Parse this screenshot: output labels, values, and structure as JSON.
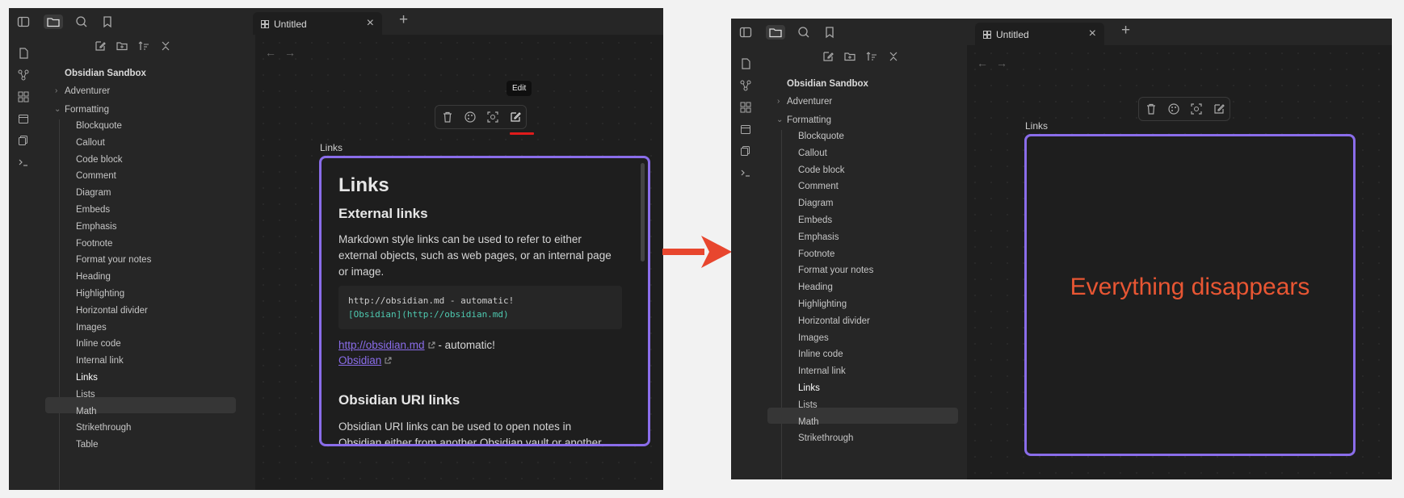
{
  "colors": {
    "accent": "#8a6dea",
    "annotation_red": "#e01b1b",
    "arrow": "#e8462e",
    "message": "#e85633"
  },
  "tab_title": "Untitled",
  "tooltip": "Edit",
  "vault": "Obsidian Sandbox",
  "tree": {
    "folders": [
      "Adventurer",
      "Formatting"
    ],
    "items": [
      "Blockquote",
      "Callout",
      "Code block",
      "Comment",
      "Diagram",
      "Embeds",
      "Emphasis",
      "Footnote",
      "Format your notes",
      "Heading",
      "Highlighting",
      "Horizontal divider",
      "Images",
      "Inline code",
      "Internal link",
      "Links",
      "Lists",
      "Math",
      "Strikethrough",
      "Table"
    ],
    "selected": "Links"
  },
  "node_toolbar_icons": [
    "trash-icon",
    "palette-icon",
    "zoom-to-fit-icon",
    "edit-icon"
  ],
  "card_label": "Links",
  "note": {
    "h1": "Links",
    "h2_external": "External links",
    "p1": "Markdown style links can be used to refer to either external objects, such as web pages, or an internal page or image.",
    "code_line1": "http://obsidian.md - automatic!",
    "code_line2": "[Obsidian](http://obsidian.md)",
    "link1": "http://obsidian.md",
    "link1_suffix": " - automatic!",
    "link2": "Obsidian",
    "h2_uri": "Obsidian URI links",
    "p2": "Obsidian URI links can be used to open notes in Obsidian either from another Obsidian vault or another program."
  },
  "message": "Everything disappears",
  "icons": {
    "top": [
      "sidebar-toggle-icon",
      "folder-icon",
      "search-icon",
      "bookmark-icon"
    ],
    "ribbon": [
      "open-quick-switcher-icon",
      "graph-view-icon",
      "canvas-icon",
      "daily-note-icon",
      "templates-icon",
      "command-palette-icon"
    ],
    "sidebar_actions": [
      "new-note-icon",
      "new-folder-icon",
      "sort-icon",
      "collapse-all-icon"
    ]
  }
}
